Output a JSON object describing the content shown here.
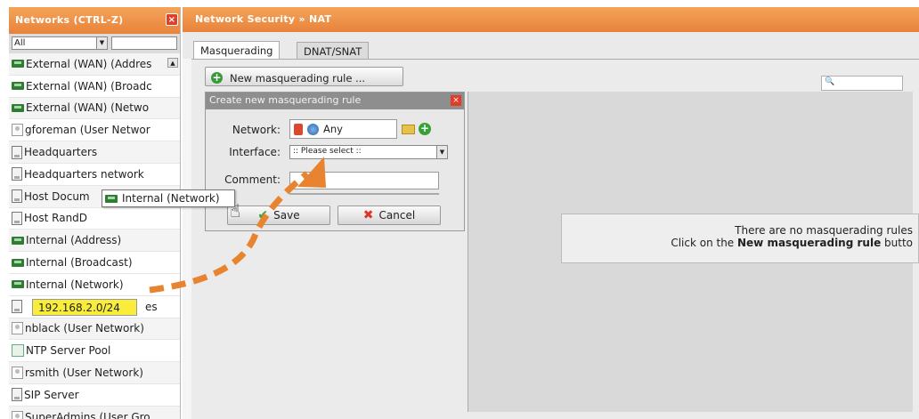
{
  "left_panel": {
    "title": "Networks (CTRL-Z)",
    "filter_value": "All",
    "items": [
      {
        "label": "External (WAN) (Addres",
        "icon": "network-icon"
      },
      {
        "label": "External (WAN) (Broadc",
        "icon": "network-icon"
      },
      {
        "label": "External (WAN) (Netwo",
        "icon": "network-icon"
      },
      {
        "label": "gforeman (User Networ",
        "icon": "user-network-icon"
      },
      {
        "label": "Headquarters",
        "icon": "host-icon"
      },
      {
        "label": "Headquarters network",
        "icon": "host-icon"
      },
      {
        "label": "Host Docum",
        "icon": "host-icon"
      },
      {
        "label": "Host RandD",
        "icon": "host-icon"
      },
      {
        "label": "Internal (Address)",
        "icon": "network-icon"
      },
      {
        "label": "Internal (Broadcast)",
        "icon": "network-icon"
      },
      {
        "label": "Internal (Network)",
        "icon": "network-icon"
      },
      {
        "label": "es",
        "icon": "host-icon"
      },
      {
        "label": "nblack (User Network)",
        "icon": "user-network-icon"
      },
      {
        "label": "NTP Server Pool",
        "icon": "pool-icon"
      },
      {
        "label": "rsmith (User Network)",
        "icon": "user-network-icon"
      },
      {
        "label": "SIP Server",
        "icon": "host-icon"
      },
      {
        "label": "SuperAdmins (User Gro",
        "icon": "user-network-icon"
      }
    ]
  },
  "right_panel": {
    "title": "Network Security » NAT",
    "tabs": [
      {
        "label": "Masquerading",
        "active": true
      },
      {
        "label": "DNAT/SNAT",
        "active": false
      }
    ],
    "new_rule_button": "New masquerading rule ...",
    "dialog": {
      "title": "Create new masquerading rule",
      "network_label": "Network:",
      "network_value": "Any",
      "interface_label": "Interface:",
      "interface_value": ":: Please select ::",
      "comment_label": "Comment:",
      "save_label": "Save",
      "cancel_label": "Cancel"
    },
    "empty_message_line1": "There are no masquerading rules",
    "empty_message_line2_prefix": "Click on the ",
    "empty_message_line2_bold": "New masquerading rule",
    "empty_message_line2_suffix": " butto"
  },
  "overlay": {
    "drag_label": "Internal (Network)",
    "ip_tag": "192.168.2.0/24"
  },
  "colors": {
    "title_bar": "#e8833a",
    "arrow": "#e8832f",
    "ip_tag": "#f9ec3a"
  }
}
